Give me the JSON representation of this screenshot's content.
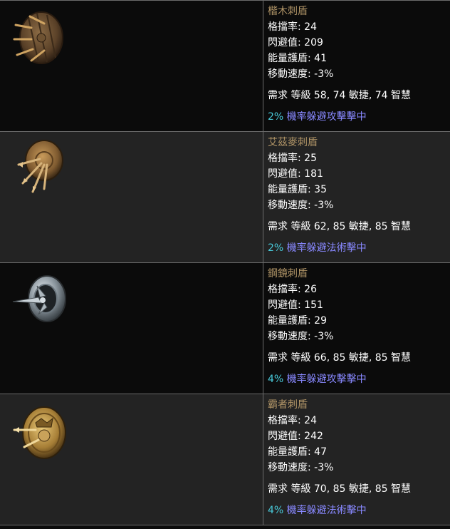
{
  "items": [
    {
      "name": "楷木刺盾",
      "block": "格擋率: 24",
      "evasion": "閃避值: 209",
      "energy_shield": "能量護盾: 41",
      "move_speed": "移動速度: -3%",
      "requirement": "需求 等級 58, 74 敏捷, 74 智慧",
      "mod_value": "2%",
      "mod_text": " 機率躲避攻擊擊中",
      "icon": "wooden-spiked-shield-icon"
    },
    {
      "name": "艾茲麥刺盾",
      "block": "格擋率: 25",
      "evasion": "閃避值: 181",
      "energy_shield": "能量護盾: 35",
      "move_speed": "移動速度: -3%",
      "requirement": "需求 等級 62, 85 敏捷, 85 智慧",
      "mod_value": "2%",
      "mod_text": " 機率躲避法術擊中",
      "icon": "ezomyte-spiked-shield-icon"
    },
    {
      "name": "鋼鏡刺盾",
      "block": "格擋率: 26",
      "evasion": "閃避值: 151",
      "energy_shield": "能量護盾: 29",
      "move_speed": "移動速度: -3%",
      "requirement": "需求 等級 66, 85 敏捷, 85 智慧",
      "mod_value": "4%",
      "mod_text": " 機率躲避攻擊擊中",
      "icon": "steel-mirror-spiked-shield-icon"
    },
    {
      "name": "霸者刺盾",
      "block": "格擋率: 24",
      "evasion": "閃避值: 242",
      "energy_shield": "能量護盾: 47",
      "move_speed": "移動速度: -3%",
      "requirement": "需求 等級 70, 85 敏捷, 85 智慧",
      "mod_value": "4%",
      "mod_text": " 機率躲避法術擊中",
      "icon": "supreme-spiked-shield-icon"
    }
  ]
}
